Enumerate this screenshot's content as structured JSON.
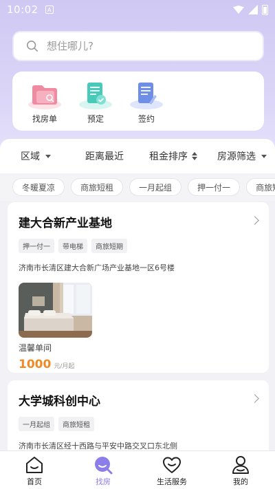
{
  "status_bar": {
    "time": "10:02",
    "sim_label": "A"
  },
  "search": {
    "placeholder": "想住哪儿?"
  },
  "quick_actions": [
    {
      "label": "找房单",
      "icon": "folder-icon"
    },
    {
      "label": "预定",
      "icon": "booking-doc-icon"
    },
    {
      "label": "签约",
      "icon": "contract-doc-icon"
    }
  ],
  "filters": [
    {
      "label": "区域"
    },
    {
      "label": "距离最近"
    },
    {
      "label": "租金排序"
    },
    {
      "label": "房源筛选"
    }
  ],
  "tags": [
    "冬暖夏凉",
    "商旅短租",
    "一月起组",
    "押一付一",
    "商旅短期"
  ],
  "listings": [
    {
      "title": "建大合新产业基地",
      "features": [
        "押一付一",
        "带电梯",
        "商旅短期"
      ],
      "address": "济南市长清区建大合新广场产业基地一区6号楼",
      "room_name": "温馨单间",
      "price": "1000",
      "price_unit": "元/月起"
    },
    {
      "title": "大学城科创中心",
      "features": [
        "一月起组",
        "商旅短租"
      ],
      "address": "济南市长清区经十西路与平安中路交叉口东北侧"
    }
  ],
  "tabs": [
    {
      "label": "首页",
      "icon": "home-icon"
    },
    {
      "label": "找房",
      "icon": "find-house-icon",
      "active": true
    },
    {
      "label": "生活服务",
      "icon": "heart-icon"
    },
    {
      "label": "我的",
      "icon": "user-icon"
    }
  ],
  "colors": {
    "accent": "#8c7ee8",
    "price": "#f08a24",
    "header_bg": "#cfc8f3"
  }
}
